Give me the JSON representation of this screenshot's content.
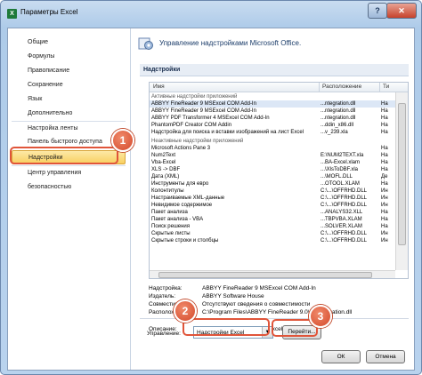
{
  "window": {
    "title": "Параметры Excel",
    "help_glyph": "?",
    "close_glyph": "✕",
    "app_glyph": "X"
  },
  "sidebar": {
    "items": [
      {
        "label": "Общие"
      },
      {
        "label": "Формулы"
      },
      {
        "label": "Правописание"
      },
      {
        "label": "Сохранение"
      },
      {
        "label": "Язык"
      },
      {
        "label": "Дополнительно"
      },
      {
        "label": "Настройка ленты"
      },
      {
        "label": "Панель быстрого доступа"
      },
      {
        "label": "Надстройки"
      },
      {
        "label": "Центр управления безопасностью"
      }
    ]
  },
  "main": {
    "header": "Управление надстройками Microsoft Office.",
    "section": "Надстройки",
    "columns": {
      "name": "Имя",
      "location": "Расположение",
      "type": "Ти"
    },
    "groups": {
      "active": "Активные надстройки приложений",
      "inactive": "Неактивные надстройки приложений"
    },
    "active_rows": [
      [
        "ABBYY FineReader 9 MSExcel COM Add-In",
        "...ntegration.dll",
        "На"
      ],
      [
        "ABBYY FineReader 9 MSExcel COM Add-In",
        "...ntegration.dll",
        "На"
      ],
      [
        "ABBYY PDF Transformer 4 MSExcel COM Add-In",
        "...ntegration.dll",
        "На"
      ],
      [
        "PhantomPDF Creator COM Addin",
        "...ddin_x86.dll",
        "На"
      ],
      [
        "Надстройка для поиска и вставки изображений на лист Excel",
        "...v_239.xla",
        "На"
      ]
    ],
    "inactive_rows": [
      [
        "Microsoft Actions Pane 3",
        "",
        "На"
      ],
      [
        "Num2Text",
        "E:\\NUM2TEXT.xla",
        "На"
      ],
      [
        "Vba-Excel",
        "...BA-Excel.xlam",
        "На"
      ],
      [
        "XLS -> DBF",
        "...\\XlsToDBF.xla",
        "На"
      ],
      [
        "Дата (XML)",
        "...\\MOFL.DLL",
        "Де"
      ],
      [
        "Инструменты для евро",
        "...OTOOL.XLAM",
        "На"
      ],
      [
        "Колонтитулы",
        "C:\\...\\OFFRHD.DLL",
        "Ин"
      ],
      [
        "Настраиваемые XML-данные",
        "C:\\...\\OFFRHD.DLL",
        "Ин"
      ],
      [
        "Невидимое содержимое",
        "C:\\...\\OFFRHD.DLL",
        "Ин"
      ],
      [
        "Пакет анализа",
        "...ANALYS32.XLL",
        "На"
      ],
      [
        "Пакет анализа - VBA",
        "...TBPVBA.XLAM",
        "На"
      ],
      [
        "Поиск решения",
        "...SOLVER.XLAM",
        "На"
      ],
      [
        "Скрытые листы",
        "C:\\...\\OFFRHD.DLL",
        "Ин"
      ],
      [
        "Скрытые строки и столбцы",
        "C:\\...\\OFFRHD.DLL",
        "Ин"
      ]
    ],
    "details": [
      {
        "label": "Надстройка:",
        "value": "ABBYY FineReader 9 MSExcel COM Add-In"
      },
      {
        "label": "Издатель:",
        "value": "ABBYY Software House"
      },
      {
        "label": "Совместимость:",
        "value": "Отсутствуют сведения о совместимости"
      },
      {
        "label": "Расположение:",
        "value": "C:\\Program Files\\ABBYY FineReader 9.0\\FRIntegration.dll"
      },
      {
        "label": "Описание:",
        "value": "ABBYY FineReader 9 MSExcel COM Add-In"
      }
    ],
    "manage_label": "Управление:",
    "manage_value": "Надстройки Excel",
    "go_button": "Перейти...",
    "ok_button": "ОК",
    "cancel_button": "Отмена"
  },
  "markers": [
    "1",
    "2",
    "3"
  ],
  "colors": {
    "accent": "#e0553a",
    "selection": "#f8cf60"
  }
}
